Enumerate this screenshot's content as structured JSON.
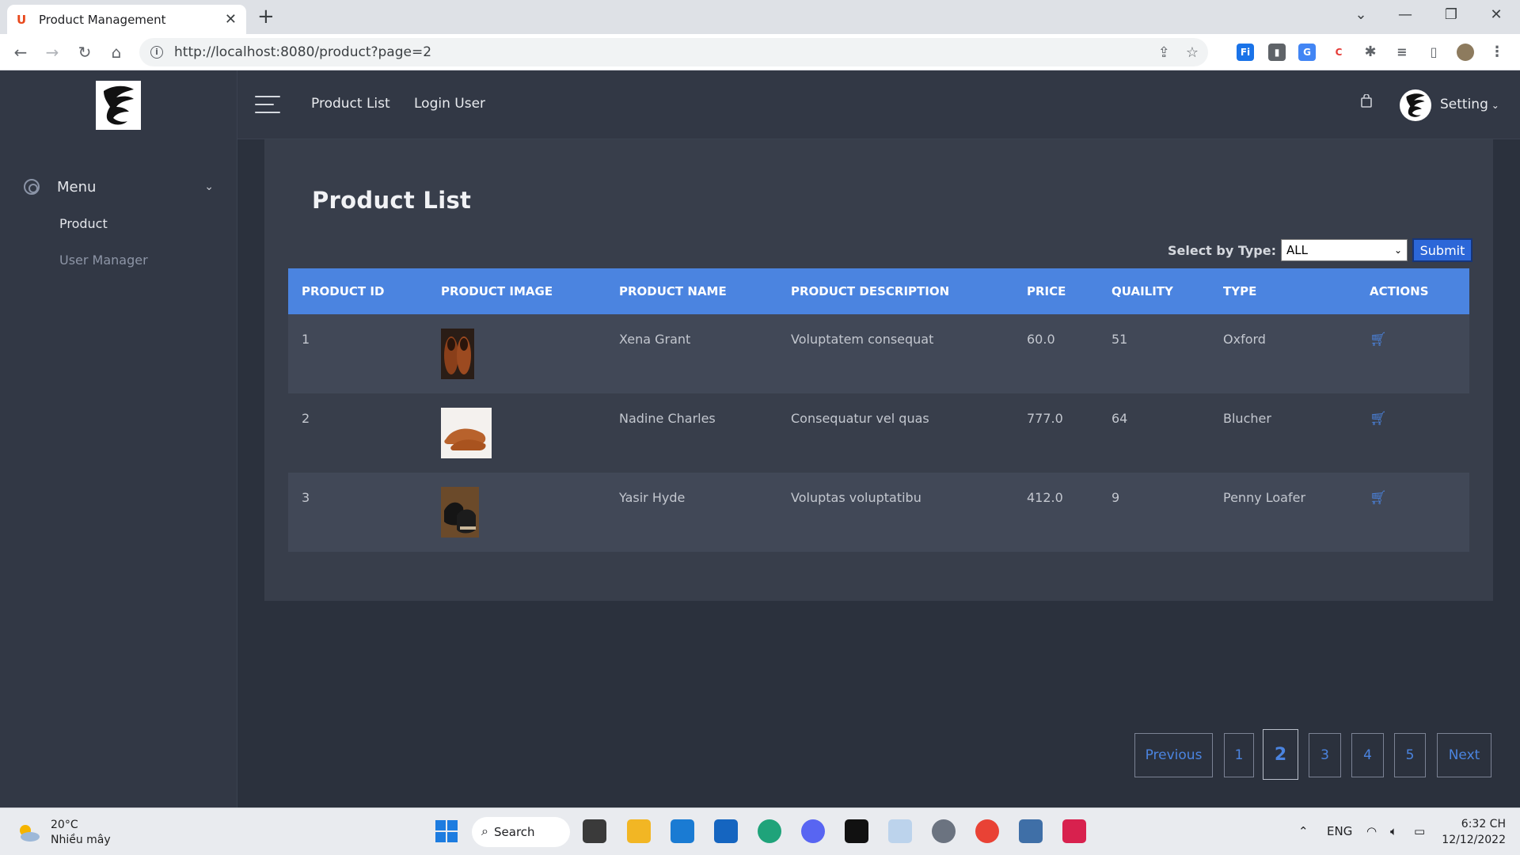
{
  "browser": {
    "tab_title": "Product Management",
    "url": "http://localhost:8080/product?page=2"
  },
  "sidebar": {
    "menu_label": "Menu",
    "items": [
      {
        "label": "Product"
      },
      {
        "label": "User Manager"
      }
    ]
  },
  "topnav": {
    "links": [
      "Product List",
      "Login User"
    ],
    "setting_label": "Setting"
  },
  "main": {
    "title": "Product List",
    "filter": {
      "label": "Select by Type:",
      "selected": "ALL",
      "submit_label": "Submit"
    },
    "columns": [
      "PRODUCT ID",
      "PRODUCT IMAGE",
      "PRODUCT NAME",
      "PRODUCT DESCRIPTION",
      "PRICE",
      "QUAILITY",
      "TYPE",
      "ACTIONS"
    ],
    "rows": [
      {
        "id": "1",
        "name": "Xena Grant",
        "description": "Voluptatem consequat",
        "price": "60.0",
        "quantity": "51",
        "type": "Oxford"
      },
      {
        "id": "2",
        "name": "Nadine Charles",
        "description": "Consequatur vel quas",
        "price": "777.0",
        "quantity": "64",
        "type": "Blucher"
      },
      {
        "id": "3",
        "name": "Yasir Hyde",
        "description": "Voluptas voluptatibu",
        "price": "412.0",
        "quantity": "9",
        "type": "Penny Loafer"
      }
    ]
  },
  "pagination": {
    "previous": "Previous",
    "pages": [
      "1",
      "2",
      "3",
      "4",
      "5"
    ],
    "current": "2",
    "next": "Next"
  },
  "taskbar": {
    "temperature": "20°C",
    "weather": "Nhiều mây",
    "search_label": "Search",
    "language": "ENG",
    "time": "6:32 CH",
    "date": "12/12/2022"
  },
  "colors": {
    "accent": "#4b84e0",
    "sidebar_bg": "#323845",
    "card_bg": "#383e4b",
    "page_bg": "#2b313d"
  }
}
